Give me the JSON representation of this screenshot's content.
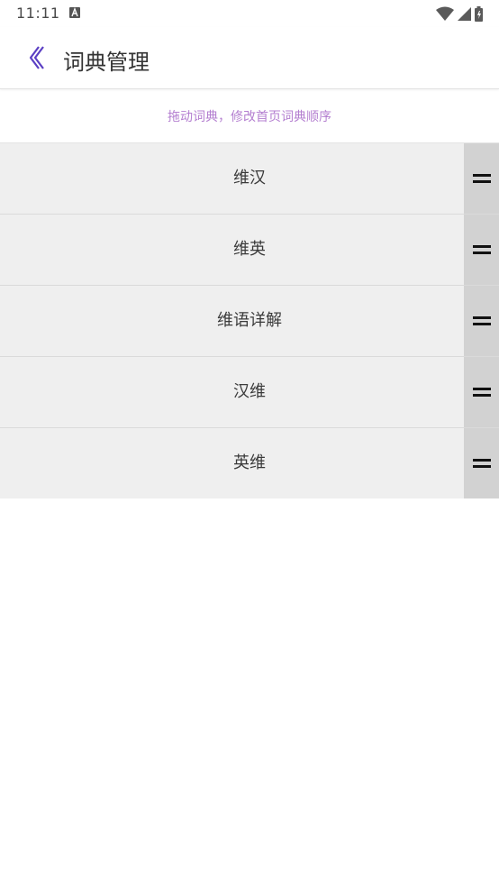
{
  "status_bar": {
    "time": "11:11",
    "icons": [
      "a-notification-icon",
      "wifi-icon",
      "cell-signal-icon",
      "battery-icon"
    ]
  },
  "header": {
    "back_icon": "chevron-left-icon",
    "title": "词典管理"
  },
  "hint": "拖动词典，修改首页词典顺序",
  "dictionaries": [
    {
      "label": "维汉"
    },
    {
      "label": "维英"
    },
    {
      "label": "维语详解"
    },
    {
      "label": "汉维"
    },
    {
      "label": "英维"
    }
  ],
  "row_handle_icon": "drag-handle-icon",
  "colors": {
    "accent": "#5b3fc4",
    "hint": "#b47fd0",
    "row_bg": "#efefef",
    "handle_bg": "#d2d2d2"
  }
}
